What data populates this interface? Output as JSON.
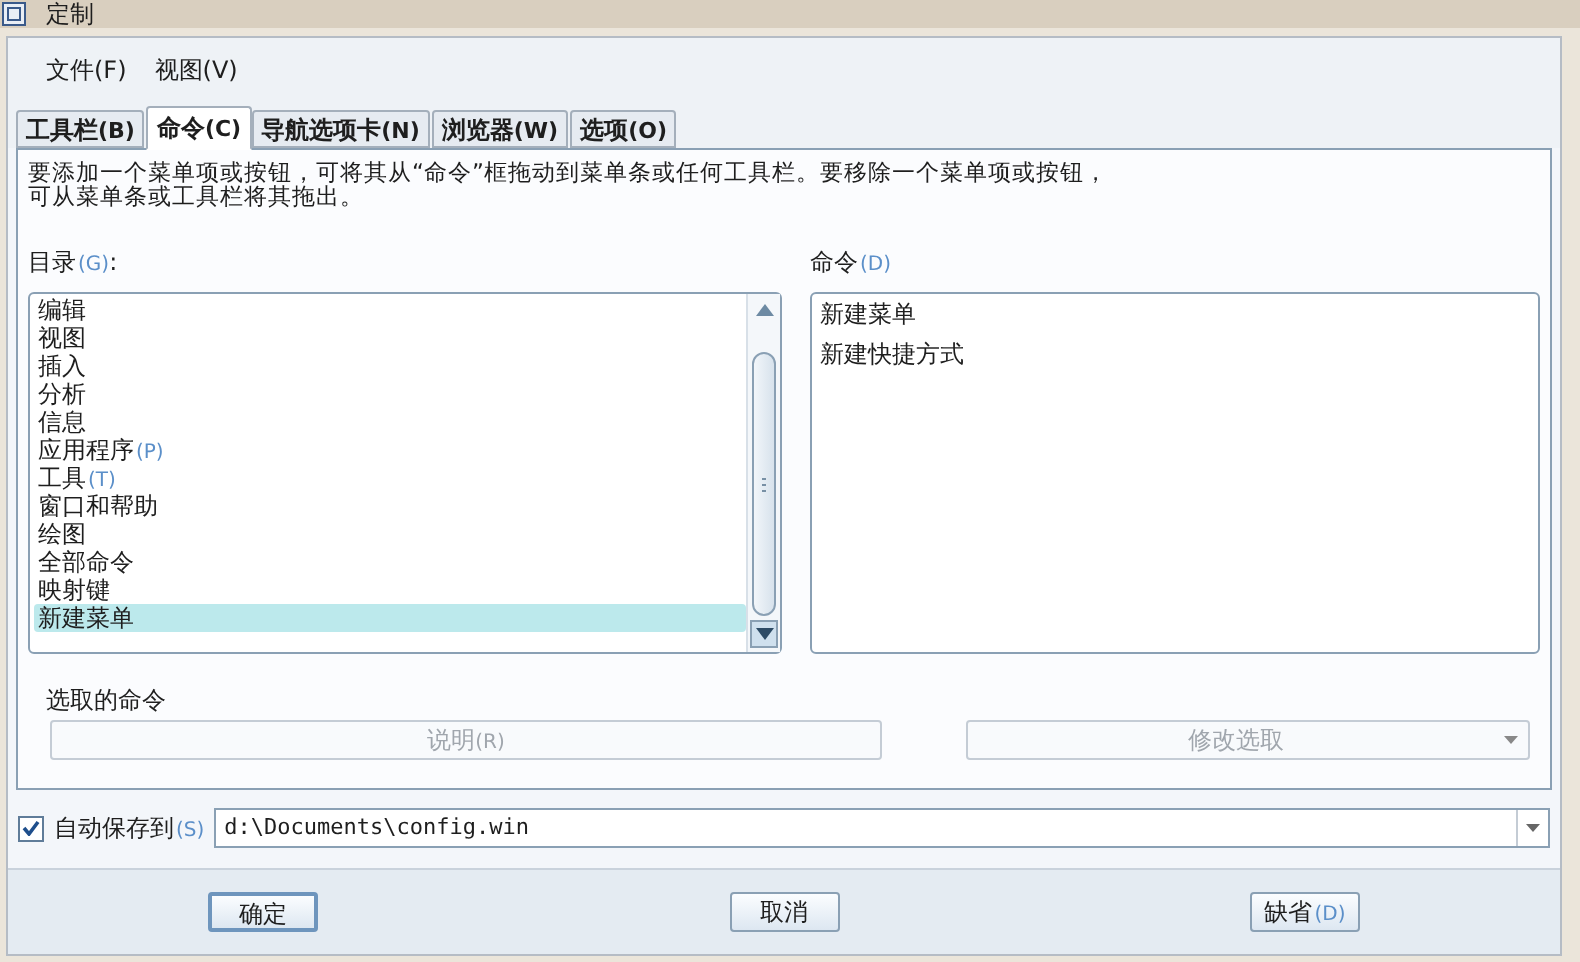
{
  "window": {
    "title": "定制"
  },
  "menu": [
    {
      "label": "文件(F)"
    },
    {
      "label": "视图(V)"
    }
  ],
  "tabs": [
    {
      "label": "工具栏",
      "hotkey": "(B)",
      "selected": false
    },
    {
      "label": "命令",
      "hotkey": "(C)",
      "selected": true
    },
    {
      "label": "导航选项卡",
      "hotkey": "(N)",
      "selected": false
    },
    {
      "label": "浏览器",
      "hotkey": "(W)",
      "selected": false
    },
    {
      "label": "选项",
      "hotkey": "(O)",
      "selected": false
    }
  ],
  "instructions": [
    "要添加一个菜单项或按钮，可将其从“命令”框拖动到菜单条或任何工具栏。要移除一个菜单项或按钮，",
    "可从菜单条或工具栏将其拖出。"
  ],
  "catalog": {
    "label": "目录",
    "hotkey": "(G)",
    "suffix": ":",
    "items": [
      {
        "label": "编辑",
        "selected": false
      },
      {
        "label": "视图",
        "selected": false
      },
      {
        "label": "插入",
        "selected": false
      },
      {
        "label": "分析",
        "selected": false
      },
      {
        "label": "信息",
        "selected": false
      },
      {
        "label": "应用程序",
        "hotkey": "(P)",
        "selected": false
      },
      {
        "label": "工具",
        "hotkey": "(T)",
        "selected": false
      },
      {
        "label": "窗口和帮助",
        "selected": false
      },
      {
        "label": "绘图",
        "selected": false
      },
      {
        "label": "全部命令",
        "selected": false
      },
      {
        "label": "映射键",
        "selected": false
      },
      {
        "label": "新建菜单",
        "selected": true
      }
    ]
  },
  "commands": {
    "label": "命令",
    "hotkey": "(D)",
    "items": [
      {
        "label": "新建菜单"
      },
      {
        "label": "新建快捷方式"
      }
    ]
  },
  "selected_command": {
    "label": "选取的命令",
    "description_button": {
      "label": "说明",
      "hotkey": "(R)",
      "disabled": true
    },
    "modify_dropdown": {
      "label": "修改选取",
      "disabled": true
    }
  },
  "autosave": {
    "label": "自动保存到",
    "hotkey": "(S)",
    "checked": true,
    "value": "d:\\Documents\\config.win"
  },
  "buttons": [
    {
      "label": "确定",
      "default": true
    },
    {
      "label": "取消",
      "default": false
    },
    {
      "label": "缺省",
      "hotkey": "(D)",
      "default": false
    }
  ]
}
